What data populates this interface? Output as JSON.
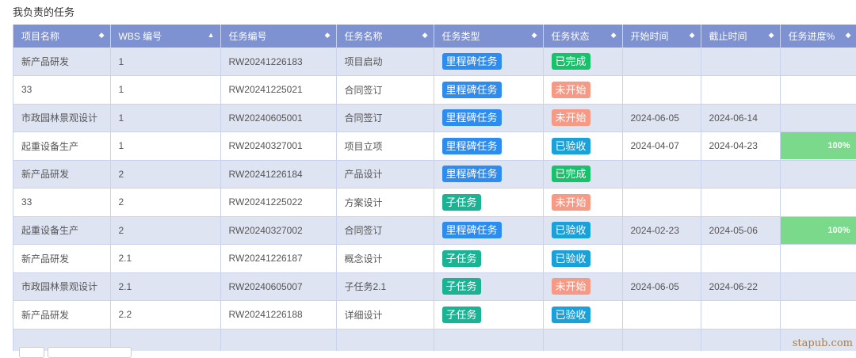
{
  "section_title": "我负责的任务",
  "watermark": "stapub.com",
  "columns": [
    {
      "label": "项目名称",
      "sort": "◆"
    },
    {
      "label": "WBS 编号",
      "sort": "▲"
    },
    {
      "label": "任务编号",
      "sort": "◆"
    },
    {
      "label": "任务名称",
      "sort": "◆"
    },
    {
      "label": "任务类型",
      "sort": "◆"
    },
    {
      "label": "任务状态",
      "sort": "◆"
    },
    {
      "label": "开始时间",
      "sort": "◆"
    },
    {
      "label": "截止时间",
      "sort": "◆"
    },
    {
      "label": "任务进度%",
      "sort": "◆"
    }
  ],
  "badge_colors": {
    "里程碑任务": "#2d8cf0",
    "子任务": "#1ab394",
    "已完成": "#18c26b",
    "未开始": "#f69a86",
    "已验收": "#1aa1d9"
  },
  "rows": [
    {
      "project": "新产品研发",
      "wbs": "1",
      "code": "RW20241226183",
      "name": "项目启动",
      "type": "里程碑任务",
      "status": "已完成",
      "start": "",
      "end": "",
      "progress": ""
    },
    {
      "project": "33",
      "wbs": "1",
      "code": "RW20241225021",
      "name": "合同签订",
      "type": "里程碑任务",
      "status": "未开始",
      "start": "",
      "end": "",
      "progress": ""
    },
    {
      "project": "市政园林景观设计",
      "wbs": "1",
      "code": "RW20240605001",
      "name": "合同签订",
      "type": "里程碑任务",
      "status": "未开始",
      "start": "2024-06-05",
      "end": "2024-06-14",
      "progress": ""
    },
    {
      "project": "起重设备生产",
      "wbs": "1",
      "code": "RW20240327001",
      "name": "项目立项",
      "type": "里程碑任务",
      "status": "已验收",
      "start": "2024-04-07",
      "end": "2024-04-23",
      "progress": "100%"
    },
    {
      "project": "新产品研发",
      "wbs": "2",
      "code": "RW20241226184",
      "name": "产品设计",
      "type": "里程碑任务",
      "status": "已完成",
      "start": "",
      "end": "",
      "progress": ""
    },
    {
      "project": "33",
      "wbs": "2",
      "code": "RW20241225022",
      "name": "方案设计",
      "type": "子任务",
      "status": "未开始",
      "start": "",
      "end": "",
      "progress": ""
    },
    {
      "project": "起重设备生产",
      "wbs": "2",
      "code": "RW20240327002",
      "name": "合同签订",
      "type": "里程碑任务",
      "status": "已验收",
      "start": "2024-02-23",
      "end": "2024-05-06",
      "progress": "100%"
    },
    {
      "project": "新产品研发",
      "wbs": "2.1",
      "code": "RW20241226187",
      "name": "概念设计",
      "type": "子任务",
      "status": "已验收",
      "start": "",
      "end": "",
      "progress": ""
    },
    {
      "project": "市政园林景观设计",
      "wbs": "2.1",
      "code": "RW20240605007",
      "name": "子任务2.1",
      "type": "子任务",
      "status": "未开始",
      "start": "2024-06-05",
      "end": "2024-06-22",
      "progress": ""
    },
    {
      "project": "新产品研发",
      "wbs": "2.2",
      "code": "RW20241226188",
      "name": "详细设计",
      "type": "子任务",
      "status": "已验收",
      "start": "",
      "end": "",
      "progress": ""
    }
  ]
}
